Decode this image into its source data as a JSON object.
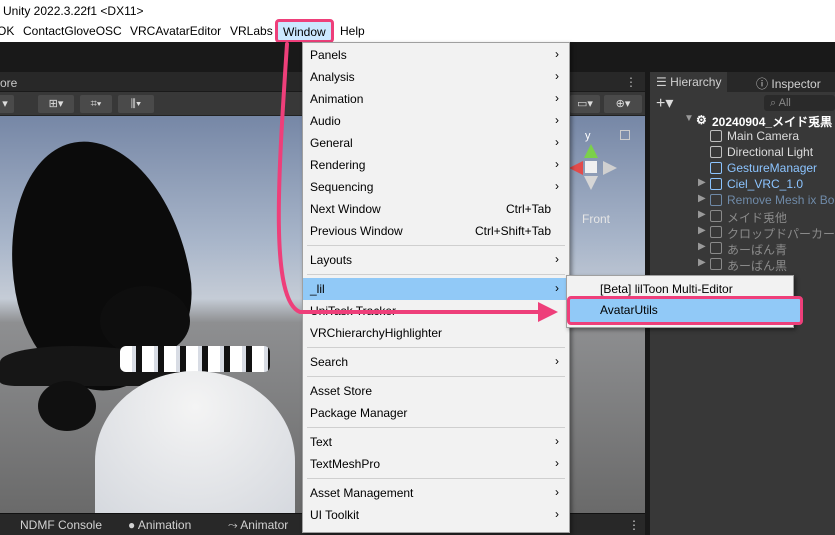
{
  "window": {
    "title": "Unity 2022.3.22f1 <DX11>"
  },
  "menubar": {
    "items": [
      "OK",
      "ContactGloveOSC",
      "VRCAvatarEditor",
      "VRLabs",
      "Window",
      "Help"
    ]
  },
  "scene": {
    "tab_label": "ore",
    "gizmo_axis_y": "y",
    "gizmo_view": "Front"
  },
  "bottom_tabs": [
    "NDMF Console",
    "Animation",
    "Animator"
  ],
  "hierarchy": {
    "tabs": [
      "Hierarchy",
      "Inspector"
    ],
    "search_placeholder": "All",
    "root": "20240904_メイド兎黒",
    "rows": [
      "Main Camera",
      "Directional Light",
      "GestureManager",
      "Ciel_VRC_1.0",
      "Remove Mesh ix Bo",
      "メイド兎他",
      "クロップドパーカーコーデ",
      "あーばん青",
      "あーばん黒"
    ]
  },
  "window_menu": {
    "items": [
      {
        "label": "Panels",
        "submenu": true
      },
      {
        "label": "Analysis",
        "submenu": true
      },
      {
        "label": "Animation",
        "submenu": true
      },
      {
        "label": "Audio",
        "submenu": true
      },
      {
        "label": "General",
        "submenu": true
      },
      {
        "label": "Rendering",
        "submenu": true
      },
      {
        "label": "Sequencing",
        "submenu": true
      },
      {
        "label": "Next Window",
        "shortcut": "Ctrl+Tab"
      },
      {
        "label": "Previous Window",
        "shortcut": "Ctrl+Shift+Tab"
      },
      {
        "label": "Layouts",
        "submenu": true
      },
      {
        "label": "_lil",
        "submenu": true,
        "highlighted": true
      },
      {
        "label": "UniTask Tracker"
      },
      {
        "label": "VRChierarchyHighlighter"
      },
      {
        "label": "Search",
        "submenu": true
      },
      {
        "label": "Asset Store"
      },
      {
        "label": "Package Manager"
      },
      {
        "label": "Text",
        "submenu": true
      },
      {
        "label": "TextMeshPro",
        "submenu": true
      },
      {
        "label": "Asset Management",
        "submenu": true
      },
      {
        "label": "UI Toolkit",
        "submenu": true
      }
    ]
  },
  "lil_submenu": {
    "items": [
      "[Beta] lilToon Multi-Editor",
      "AvatarUtils"
    ]
  },
  "colors": {
    "accent": "#ee3f7a",
    "menu_highlight": "#91c9f7",
    "prefab_blue": "#8cc4ff"
  }
}
